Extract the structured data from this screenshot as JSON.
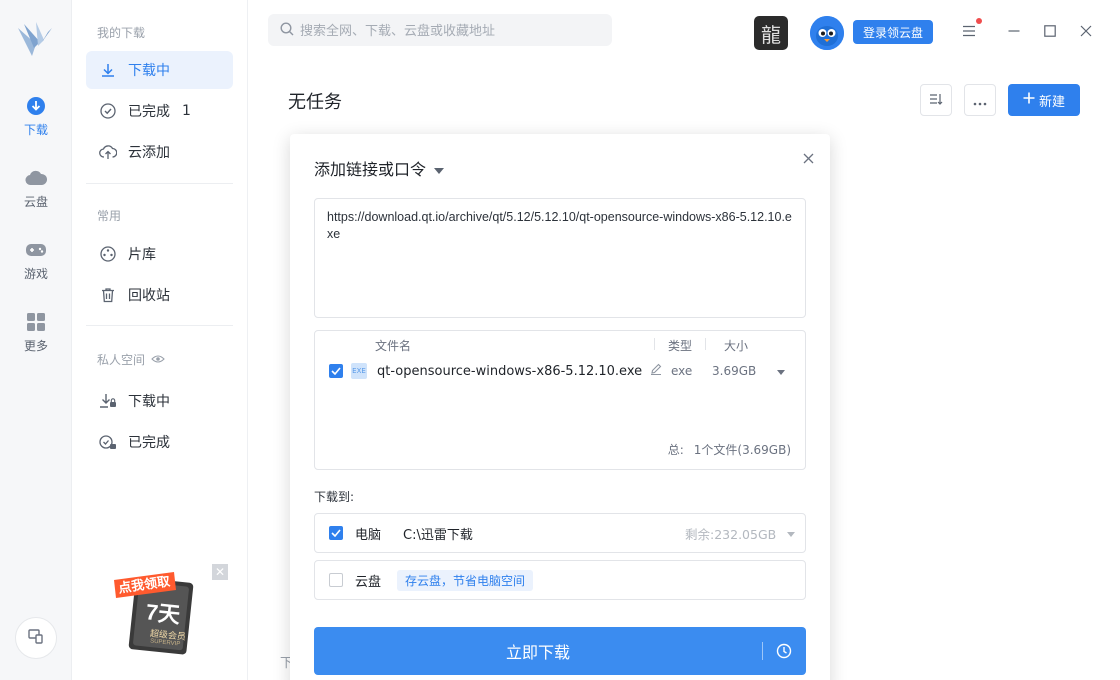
{
  "rail": {
    "items": [
      {
        "label": "下载",
        "icon": "download-circle-icon",
        "active": true
      },
      {
        "label": "云盘",
        "icon": "cloud-icon",
        "active": false
      },
      {
        "label": "游戏",
        "icon": "gamepad-icon",
        "active": false
      },
      {
        "label": "更多",
        "icon": "grid-icon",
        "active": false
      }
    ]
  },
  "sidebar": {
    "section_downloads": "我的下载",
    "downloading": "下载中",
    "completed": "已完成",
    "completed_count": "1",
    "cloud_add": "云添加",
    "section_common": "常用",
    "library": "片库",
    "recycle": "回收站",
    "section_private": "私人空间",
    "private_downloading": "下载中",
    "private_completed": "已完成",
    "promo_top": "点我领取",
    "promo_days": "7天",
    "promo_vip": "超级会员",
    "promo_supervip": "SUPERVIP"
  },
  "topbar": {
    "search_placeholder": "搜索全网、下载、云盘或收藏地址",
    "login_label": "登录领云盘",
    "dragon_glyph": "龍"
  },
  "main": {
    "title": "无任务",
    "new_label": "新建",
    "bg_text": "下"
  },
  "dialog": {
    "title": "添加链接或口令",
    "url": "https://download.qt.io/archive/qt/5.12/5.12.10/qt-opensource-windows-x86-5.12.10.exe",
    "col_name": "文件名",
    "col_type": "类型",
    "col_size": "大小",
    "file_name": "qt-opensource-windows-x86-5.12.10.exe",
    "file_type": "exe",
    "file_size": "3.69GB",
    "file_icon_text": "EXE",
    "total_label": "总:",
    "total_value": "1个文件(3.69GB)",
    "save_to_label": "下载到:",
    "pc_label": "电脑",
    "pc_path": "C:\\迅雷下载",
    "pc_free": "剩余:232.05GB",
    "cloud_label": "云盘",
    "cloud_tag": "存云盘，节省电脑空间",
    "download_now": "立即下载"
  }
}
